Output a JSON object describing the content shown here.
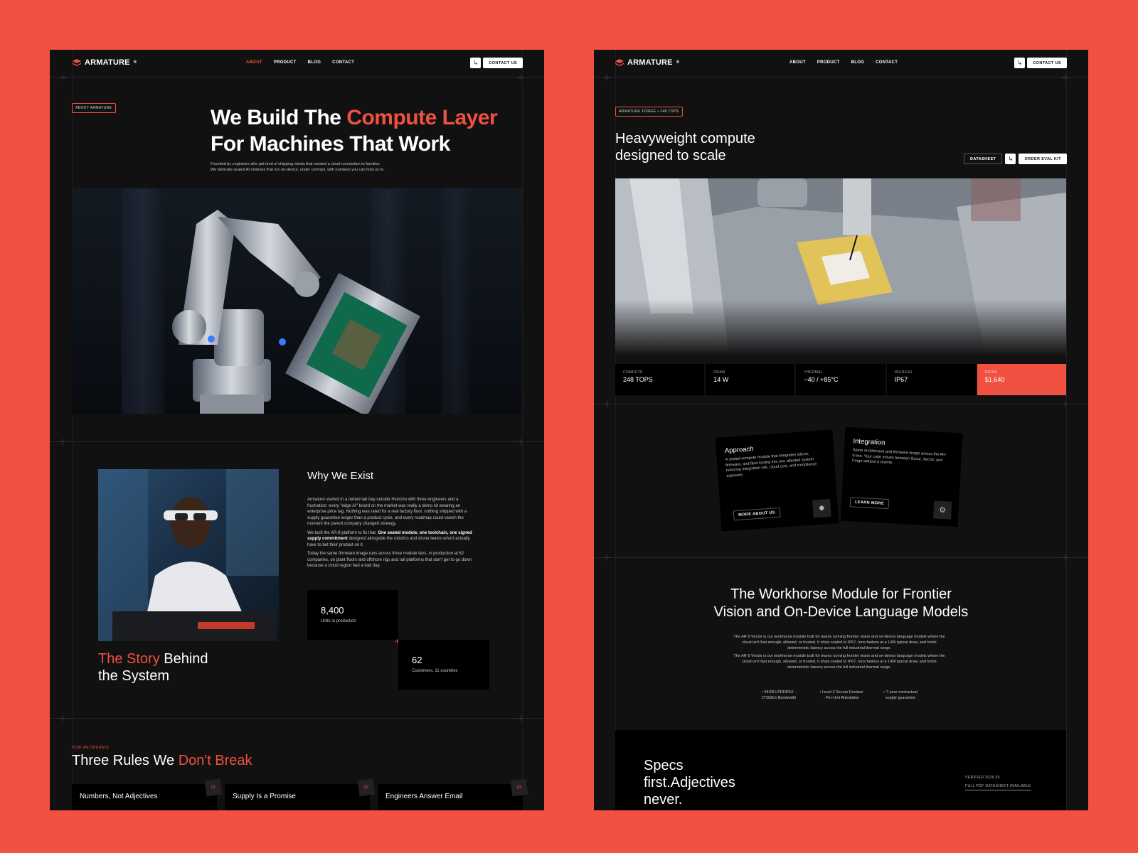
{
  "brand": "ARMATURE",
  "colors": {
    "accent": "#f05140",
    "bg": "#111111",
    "outer": "#f05140"
  },
  "left": {
    "nav": {
      "about": "ABOUT",
      "product": "PRODUCT",
      "blog": "BLOG",
      "contact": "CONTACT",
      "cta": "CONTACT US"
    },
    "tag": "ABOUT ARMATURE",
    "hero": {
      "title_a": "We Build The ",
      "title_accent": "Compute Layer",
      "title_b": "For Machines That Work",
      "sub1": "Founded by engineers who got tired of shipping robots that needed a cloud connection to function.",
      "sub2": "We fabricate sealed AI modules that run on-device, under contract, with numbers you can hold us to."
    },
    "story": {
      "accent": "The Story",
      "rest1": " Behind",
      "rest2": "the System",
      "why": "Why We Exist",
      "p1": "Armature started in a rented lab bay outside Hsinchu with three engineers and a frustration: every \"edge AI\" board on the market was really a demo kit wearing an enterprise price tag. Nothing was rated for a real factory floor, nothing shipped with a supply guarantee longer than a product cycle, and every roadmap could vanish the moment the parent company changed strategy.",
      "p2a": "We built the AR-9 platform to fix that. ",
      "p2b": "One sealed module, one toolchain, one signed supply commitment",
      "p2c": " designed alongside the robotics and drone teams who'd actually have to bet their product on it.",
      "p3": "Today the same firmware image runs across three module tiers, in production at 62 companies, on plant floors and offshore rigs and rail platforms that don't get to go down because a cloud region had a bad day.",
      "stat1_value": "8,400",
      "stat1_label": "Units in production",
      "stat2_value": "62",
      "stat2_label": "Customers, 11 countries"
    },
    "rules": {
      "eyebrow": "HOW WE OPERATE",
      "title_a": "Three Rules We ",
      "title_accent": "Don't Break",
      "items": [
        {
          "num": "01",
          "label": "Numbers, Not Adjectives"
        },
        {
          "num": "02",
          "label": "Supply Is a Promise"
        },
        {
          "num": "03",
          "label": "Engineers Answer Email"
        }
      ]
    }
  },
  "right": {
    "nav": {
      "about": "ABOUT",
      "product": "PRODUCT",
      "blog": "BLOG",
      "contact": "CONTACT",
      "cta": "CONTACT US"
    },
    "tag": "ARMATURE FORGE • 248 TOPS",
    "hero": {
      "title1": "Heavyweight compute",
      "title2": "designed to scale",
      "datasheet": "DATASHEET",
      "order": "ORDER EVAL KIT"
    },
    "specs": [
      {
        "label": "COMPUTE",
        "value": "248 TOPS"
      },
      {
        "label": "DRAW",
        "value": "14 W"
      },
      {
        "label": "THERMAL",
        "value": "−40 / +85°C"
      },
      {
        "label": "INGRESS",
        "value": "IP67"
      },
      {
        "label": "FROM",
        "value": "$1,640"
      }
    ],
    "cards": [
      {
        "title": "Approach",
        "body": "A sealed compute module that integrates silicon, firmware, and fleet tooling into one attested system reducing integration risk, cloud cost, and compliance exposure.",
        "button": "MORE ABOUT US"
      },
      {
        "title": "Integration",
        "body": "Same architecture and firmware image across the AR-9 line. Your code moves between Scout, Vector, and Forge without a rewrite.",
        "button": "LEARN MORE"
      }
    ],
    "workhorse": {
      "title1": "The Workhorse Module for Frontier",
      "title2": "Vision and On-Device Language Models",
      "p1": "The AR-9 Vector is our workhorse module built for teams running frontier vision and on-device language models where the cloud isn't fast enough, allowed, or trusted. It ships sealed to IP67, runs fanless at a 14W typical draw, and holds deterministic latency across the full industrial thermal range.",
      "p2": "The AR-9 Vector is our workhorse module built for teams running frontier vision and on-device language models where the cloud isn't fast enough, allowed, or trusted. It ships sealed to IP67, runs fanless at a 14W typical draw, and holds deterministic latency across the full industrial thermal range.",
      "bullets": [
        [
          "• 64GB LPDDR5X ·",
          "273GB/s Bandwidth"
        ],
        [
          "• Level 3 Secure Enclave",
          "· Per-Unit Attestation"
        ],
        [
          "• 7-year contractual",
          "supply guarantee"
        ]
      ]
    },
    "specs_first": {
      "l1": "Specs",
      "l2": "first.Adjectives",
      "l3": "never.",
      "verified": "VERIFIED 2026.06",
      "pdf": "FULL PDF DATASHEET AVAILABLE"
    }
  }
}
